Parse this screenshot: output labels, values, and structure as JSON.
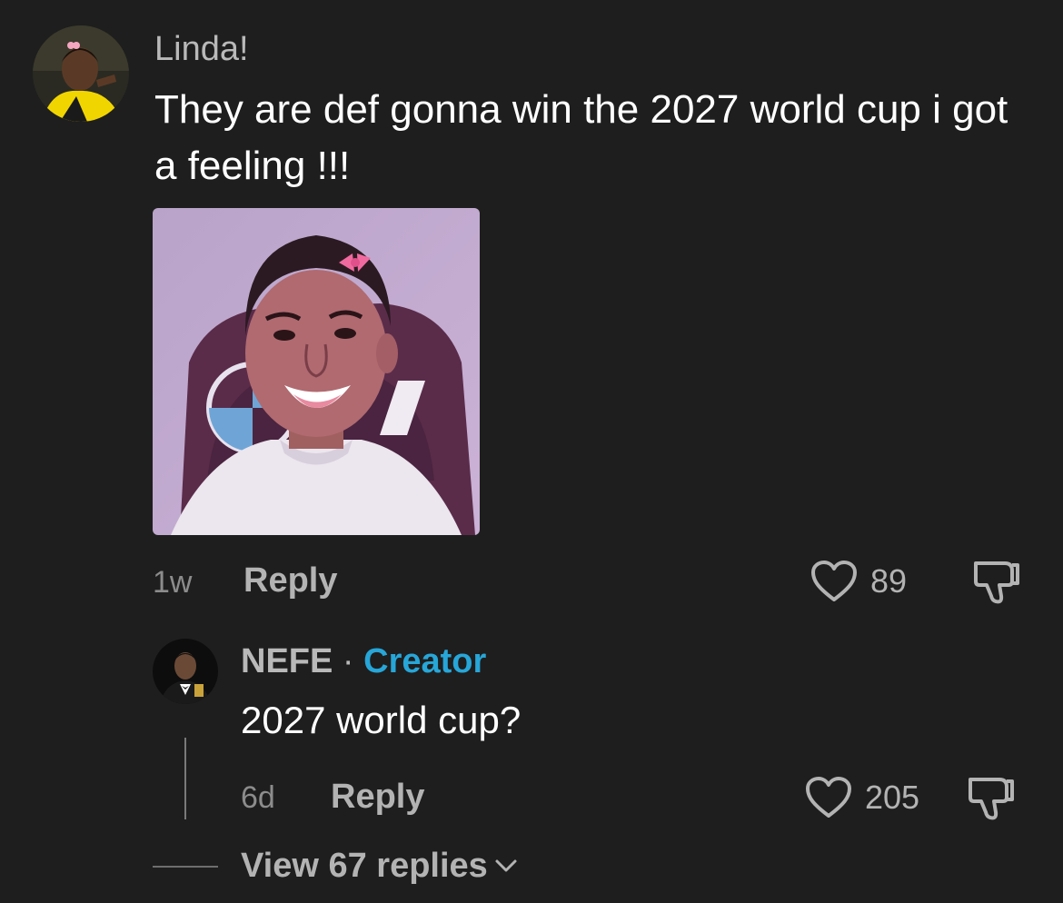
{
  "comment": {
    "username": "Linda!",
    "text": "They are def gonna win the 2027 world cup i got a feeling !!!",
    "time": "1w",
    "reply_label": "Reply",
    "likes": "89",
    "avatar_icon": "user-avatar",
    "image_icon": "attached-image"
  },
  "reply": {
    "username": "NEFE",
    "separator": "·",
    "badge": "Creator",
    "text": "2027 world cup?",
    "time": "6d",
    "reply_label": "Reply",
    "likes": "205",
    "avatar_icon": "user-avatar"
  },
  "view_replies_label": "View 67 replies",
  "colors": {
    "background": "#1e1e1e",
    "creator_badge": "#27a6d8",
    "muted_text": "#b3b3b3"
  }
}
